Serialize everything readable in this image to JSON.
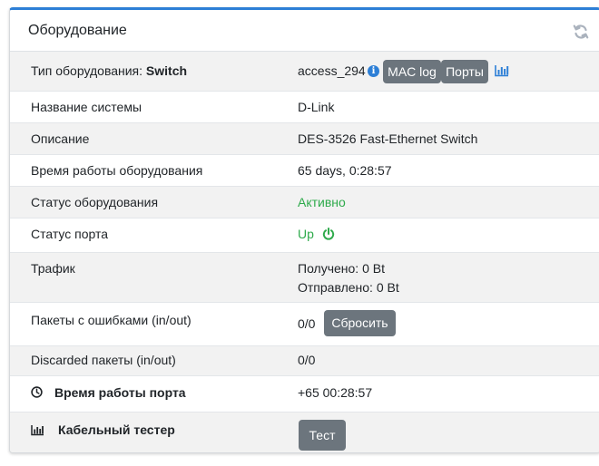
{
  "card": {
    "title": "Оборудование"
  },
  "rows": {
    "device_type": {
      "label": "Тип оборудования:",
      "type_value": "Switch",
      "name": "access_294",
      "mac_log_button": "MAC log",
      "ports_button": "Порты"
    },
    "system_name": {
      "label": "Название системы",
      "value": "D-Link"
    },
    "description": {
      "label": "Описание",
      "value": "DES-3526 Fast-Ethernet Switch"
    },
    "uptime": {
      "label": "Время работы оборудования",
      "value": "65 days, 0:28:57"
    },
    "device_status": {
      "label": "Статус оборудования",
      "value": "Активно"
    },
    "port_status": {
      "label": "Статус порта",
      "value": "Up"
    },
    "traffic": {
      "label": "Трафик",
      "received": "Получено: 0 Bt",
      "sent": "Отправлено: 0 Bt"
    },
    "error_packets": {
      "label": "Пакеты с ошибками (in/out)",
      "value": "0/0",
      "reset_button": "Сбросить"
    },
    "discarded": {
      "label": "Discarded пакеты (in/out)",
      "value": "0/0"
    },
    "port_uptime": {
      "label": "Время работы порта",
      "value": "+65 00:28:57"
    },
    "cable_tester": {
      "label": "Кабельный тестер",
      "test_button": "Тест"
    }
  },
  "colors": {
    "accent": "#2d7fd6",
    "status_green": "#2eaa4b",
    "button_gray": "#6c757d"
  },
  "icons": [
    "refresh-icon",
    "info-icon",
    "chart-icon",
    "power-icon",
    "clock-icon",
    "chart-icon"
  ]
}
